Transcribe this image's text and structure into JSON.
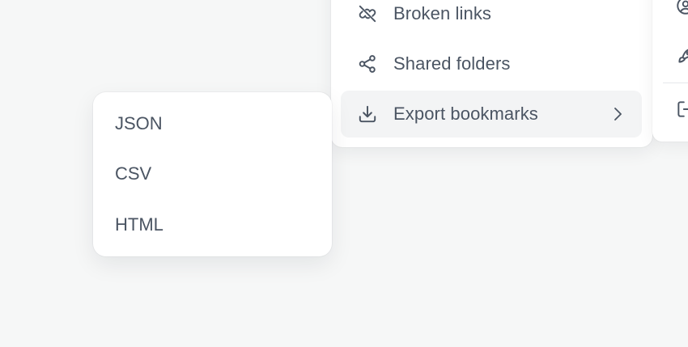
{
  "menu": {
    "items": [
      {
        "label": "Broken links",
        "icon": "broken-link-icon"
      },
      {
        "label": "Shared folders",
        "icon": "share-icon"
      },
      {
        "label": "Export bookmarks",
        "icon": "download-icon",
        "has_submenu": true,
        "active": true
      }
    ]
  },
  "submenu": {
    "items": [
      {
        "label": "JSON"
      },
      {
        "label": "CSV"
      },
      {
        "label": "HTML"
      }
    ]
  },
  "side_panel": {
    "icons": [
      "user-circle-icon",
      "rocket-icon",
      "logout-icon"
    ]
  },
  "colors": {
    "background": "#f6f7f7",
    "surface": "#ffffff",
    "text": "#4b5563",
    "hover": "#f3f4f5"
  }
}
